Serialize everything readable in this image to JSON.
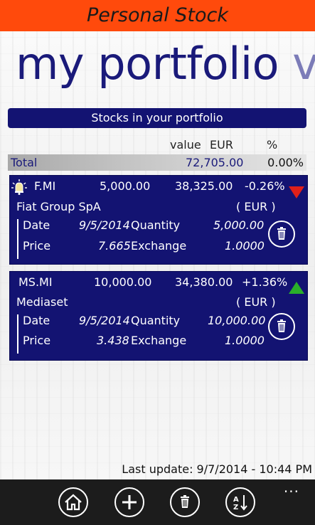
{
  "app": {
    "title": "Personal Stock"
  },
  "pivot": {
    "current": "my portfolio",
    "next": "vi"
  },
  "portfolio": {
    "header": "Stocks in your portfolio",
    "columns": {
      "value": "value",
      "currency": "EUR",
      "percent": "%"
    },
    "total": {
      "label": "Total",
      "value": "72,705.00",
      "percent": "0.00%"
    },
    "stocks": [
      {
        "symbol": "F.MI",
        "quantity": "5,000.00",
        "value": "38,325.00",
        "change": "-0.26%",
        "trend": "down",
        "has_alert": true,
        "name": "Fiat Group SpA",
        "currency": "( EUR )",
        "date_label": "Date",
        "date": "9/5/2014",
        "quantity_label": "Quantity",
        "quantity_detail": "5,000.00",
        "price_label": "Price",
        "price": "7.665",
        "exchange_label": "Exchange",
        "exchange": "1.0000"
      },
      {
        "symbol": "MS.MI",
        "quantity": "10,000.00",
        "value": "34,380.00",
        "change": "+1.36%",
        "trend": "up",
        "has_alert": false,
        "name": "Mediaset",
        "currency": "( EUR )",
        "date_label": "Date",
        "date": "9/5/2014",
        "quantity_label": "Quantity",
        "quantity_detail": "10,000.00",
        "price_label": "Price",
        "price": "3.438",
        "exchange_label": "Exchange",
        "exchange": "1.0000"
      }
    ]
  },
  "status": {
    "last_update": "Last update: 9/7/2014 - 10:44 PM"
  },
  "app_bar": {
    "buttons": [
      "home-icon",
      "add-icon",
      "delete-icon",
      "sort-az-icon"
    ],
    "more": "..."
  },
  "colors": {
    "title_bar": "#ff4a0c",
    "accent": "#131372",
    "loss": "#e0201a",
    "gain": "#2ab02a"
  }
}
